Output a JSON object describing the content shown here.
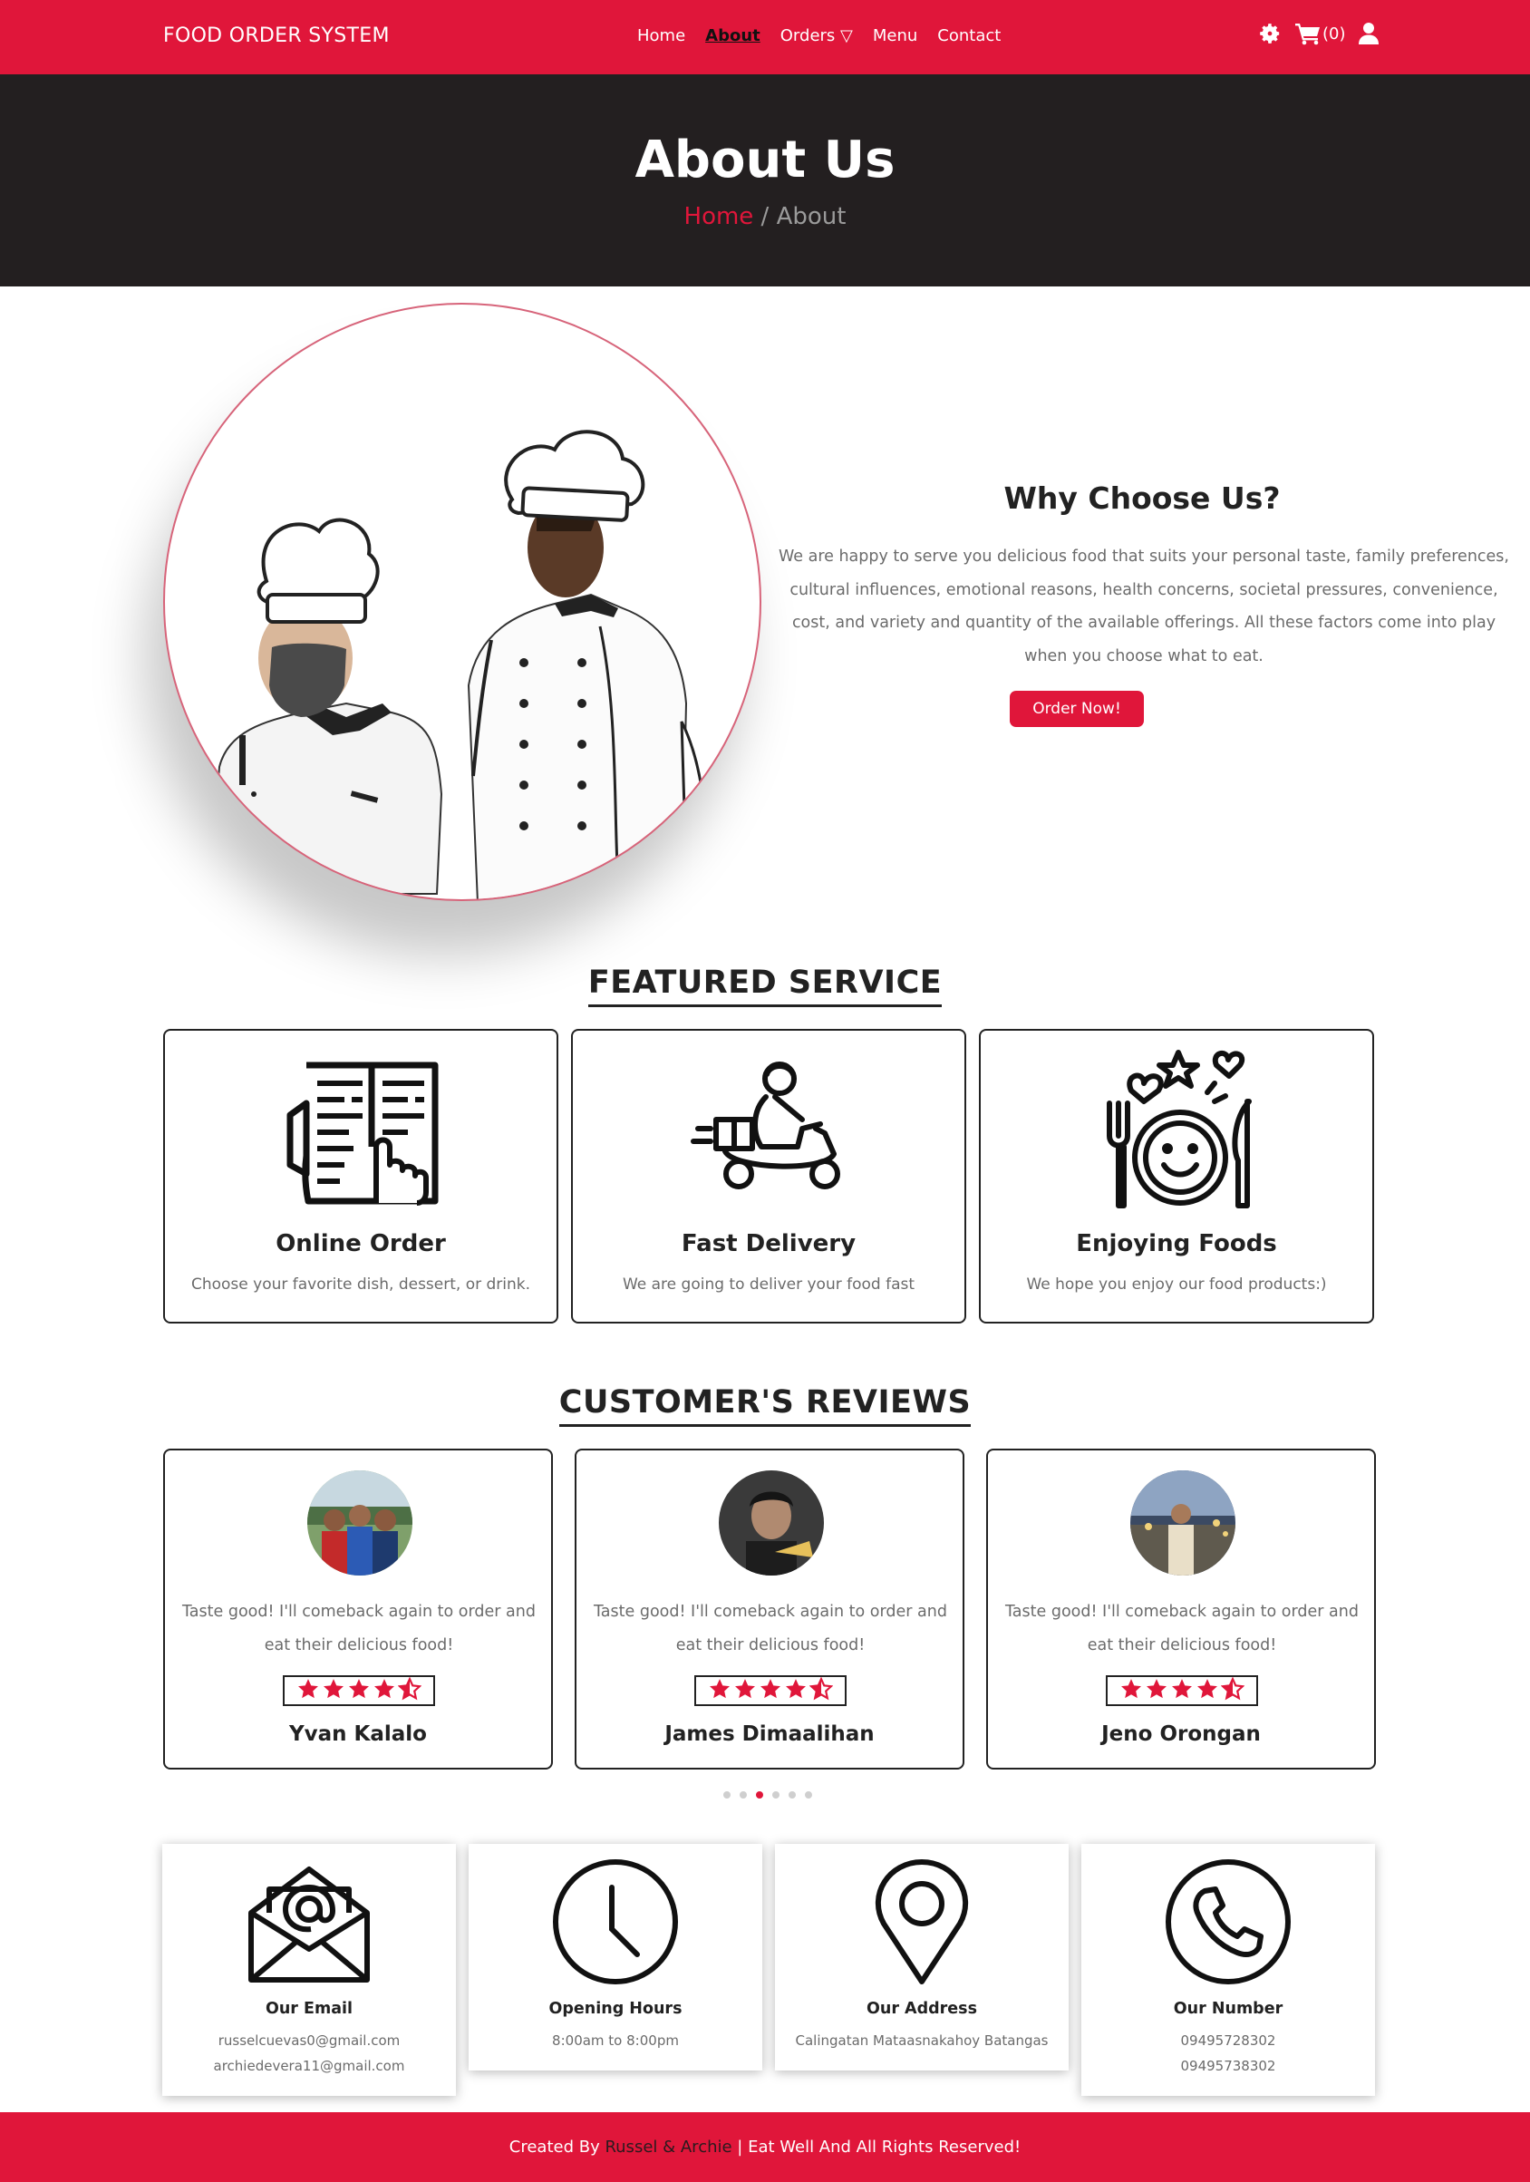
{
  "nav": {
    "brand": "FOOD ORDER SYSTEM",
    "links": [
      "Home",
      "About",
      "Orders ▽",
      "Menu",
      "Contact"
    ],
    "cart_count": "(0)"
  },
  "hero": {
    "title": "About Us",
    "crumb_home": "Home",
    "crumb_sep": " / ",
    "crumb_current": "About"
  },
  "about": {
    "title": "Why Choose Us?",
    "text": "We are happy to serve you delicious food that suits your personal taste, family preferences, cultural influences, emotional reasons, health concerns, societal pressures, convenience, cost, and variety and quantity of the available offerings. All these factors come into play when you choose what to eat.",
    "button": "Order Now!"
  },
  "services": {
    "title": "FEATURED SERVICE",
    "items": [
      {
        "name": "Online Order",
        "desc": "Choose your favorite dish, dessert, or drink.",
        "icon": "menu-tap-icon"
      },
      {
        "name": "Fast Delivery",
        "desc": "We are going to deliver your food fast",
        "icon": "delivery-scooter-icon"
      },
      {
        "name": "Enjoying Foods",
        "desc": "We hope you enjoy our food products:)",
        "icon": "happy-plate-icon"
      }
    ]
  },
  "reviews": {
    "title": "CUSTOMER'S REVIEWS",
    "items": [
      {
        "text": "Taste good! I'll comeback again to order and eat their delicious food!",
        "name": "Yvan Kalalo",
        "rating": 4.5
      },
      {
        "text": "Taste good! I'll comeback again to order and eat their delicious food!",
        "name": "James Dimaalihan",
        "rating": 4.5
      },
      {
        "text": "Taste good! I'll comeback again to order and eat their delicious food!",
        "name": "Jeno Orongan",
        "rating": 4.5
      }
    ],
    "active_dot": 3,
    "dot_count": 6
  },
  "contact": {
    "items": [
      {
        "title": "Our Email",
        "lines": [
          "russelcuevas0@gmail.com",
          "archiedevera11@gmail.com"
        ],
        "icon": "email-icon"
      },
      {
        "title": "Opening Hours",
        "lines": [
          "8:00am to 8:00pm"
        ],
        "icon": "clock-icon"
      },
      {
        "title": "Our Address",
        "lines": [
          "Calingatan Mataasnakahoy Batangas"
        ],
        "icon": "location-pin-icon"
      },
      {
        "title": "Our Number",
        "lines": [
          "09495728302",
          "09495738302"
        ],
        "icon": "phone-icon"
      }
    ]
  },
  "footer": {
    "prefix": "Created By ",
    "names": "Russel & Archie",
    "suffix": " | Eat Well And All Rights Reserved!"
  },
  "colors": {
    "accent": "#e0163a",
    "hero_bg": "#231f20",
    "text": "#222222",
    "muted": "#6b6b6b"
  }
}
